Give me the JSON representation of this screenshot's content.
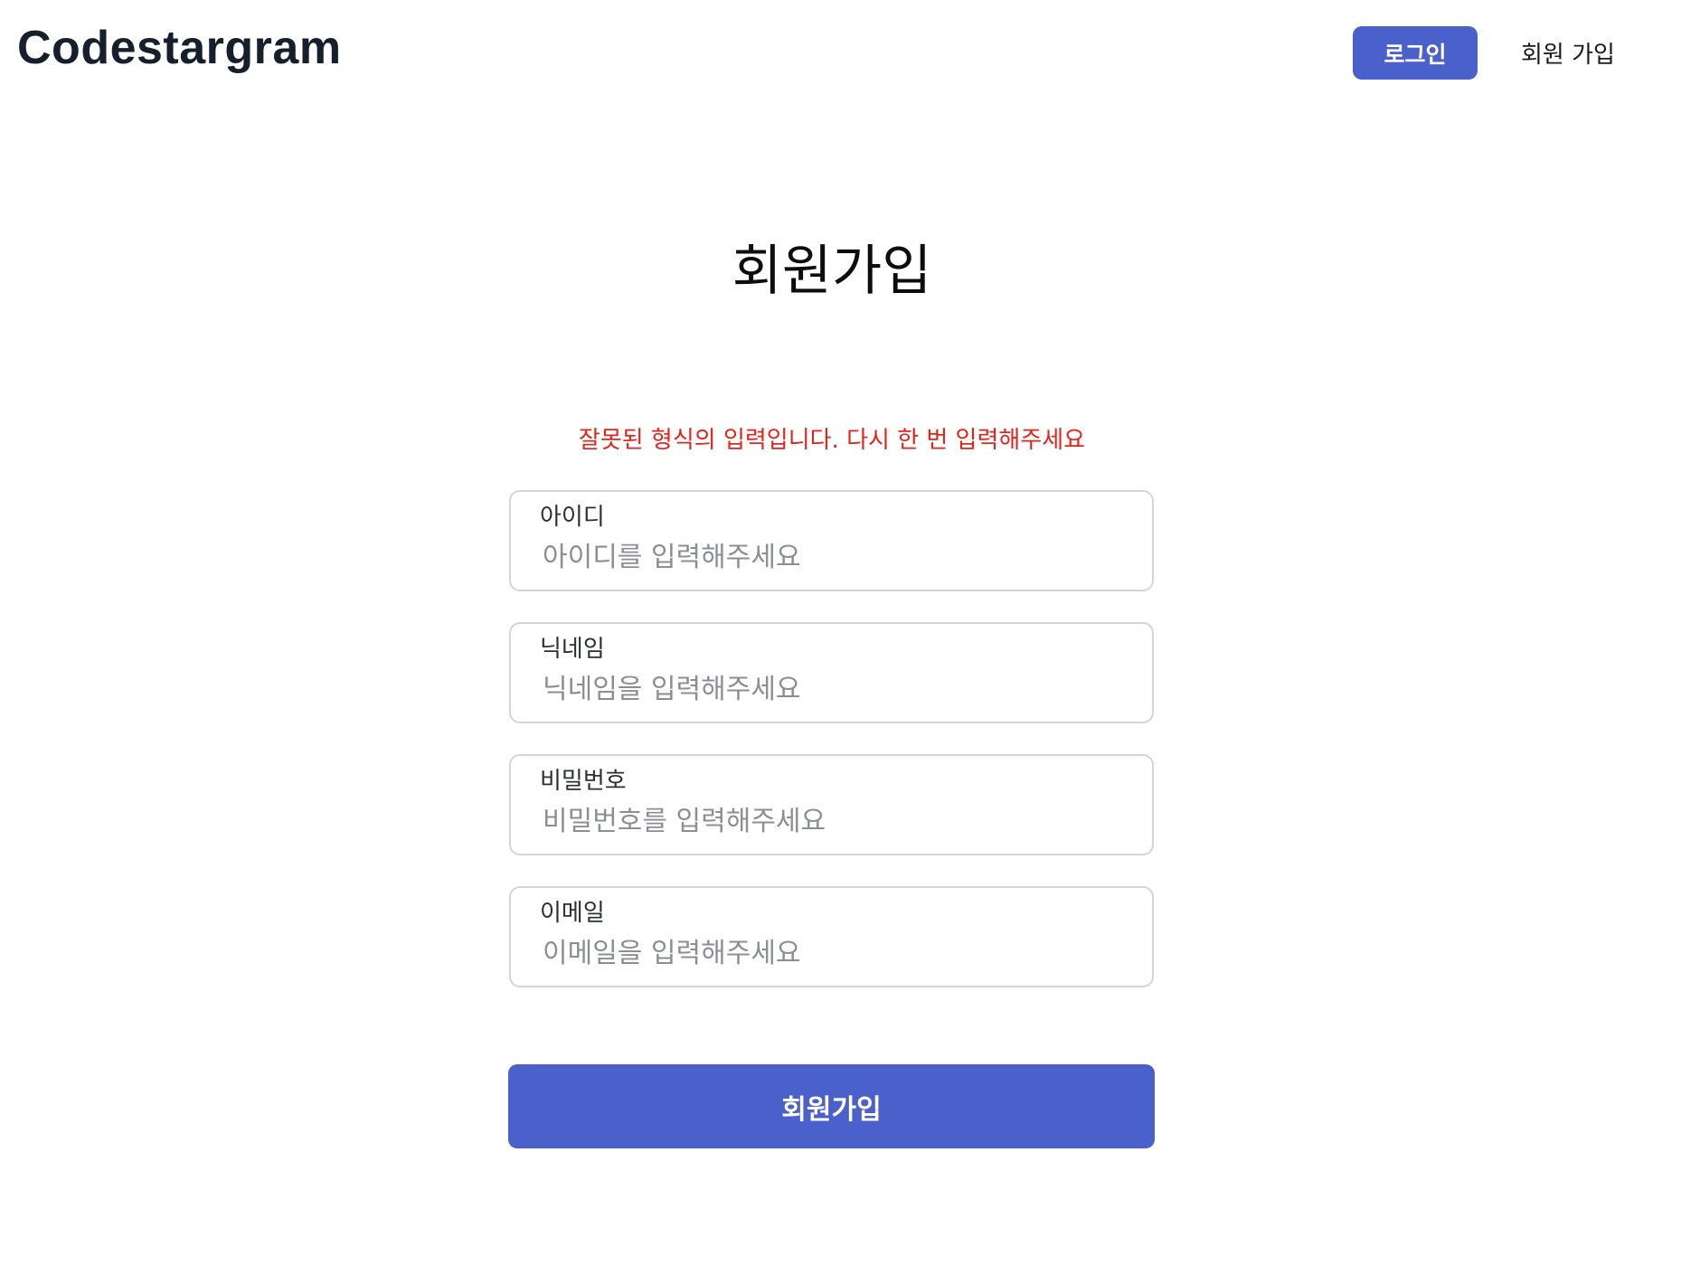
{
  "header": {
    "logo": "Codestargram",
    "nav": {
      "login_label": "로그인",
      "signup_label": "회원 가입"
    }
  },
  "main": {
    "title": "회원가입",
    "error_message": "잘못된 형식의 입력입니다. 다시 한 번 입력해주세요",
    "fields": [
      {
        "label": "아이디",
        "placeholder": "아이디를 입력해주세요",
        "value": ""
      },
      {
        "label": "닉네임",
        "placeholder": "닉네임을 입력해주세요",
        "value": ""
      },
      {
        "label": "비밀번호",
        "placeholder": "비밀번호를 입력해주세요",
        "value": ""
      },
      {
        "label": "이메일",
        "placeholder": "이메일을 입력해주세요",
        "value": ""
      }
    ],
    "submit_label": "회원가입"
  },
  "colors": {
    "accent": "#4a60cb",
    "error": "#e3241b",
    "logo": "#16202c",
    "field_border": "#d3d5d8",
    "placeholder": "#8b8f95"
  }
}
